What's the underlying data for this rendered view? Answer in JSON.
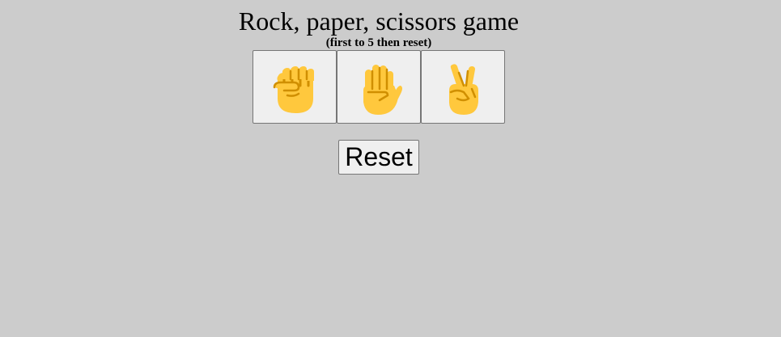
{
  "header": {
    "title": "Rock, paper, scissors game",
    "subtitle": "(first to 5 then reset)"
  },
  "choices": [
    {
      "id": "rock",
      "icon": "raised-fist-icon"
    },
    {
      "id": "paper",
      "icon": "raised-hand-icon"
    },
    {
      "id": "scissors",
      "icon": "victory-hand-icon"
    }
  ],
  "controls": {
    "reset_label": "Reset"
  },
  "colors": {
    "background": "#cccccc",
    "button_face": "#efefef",
    "button_border": "#767676",
    "skin": "#ffc83d",
    "skin_shadow": "#d08f00"
  }
}
